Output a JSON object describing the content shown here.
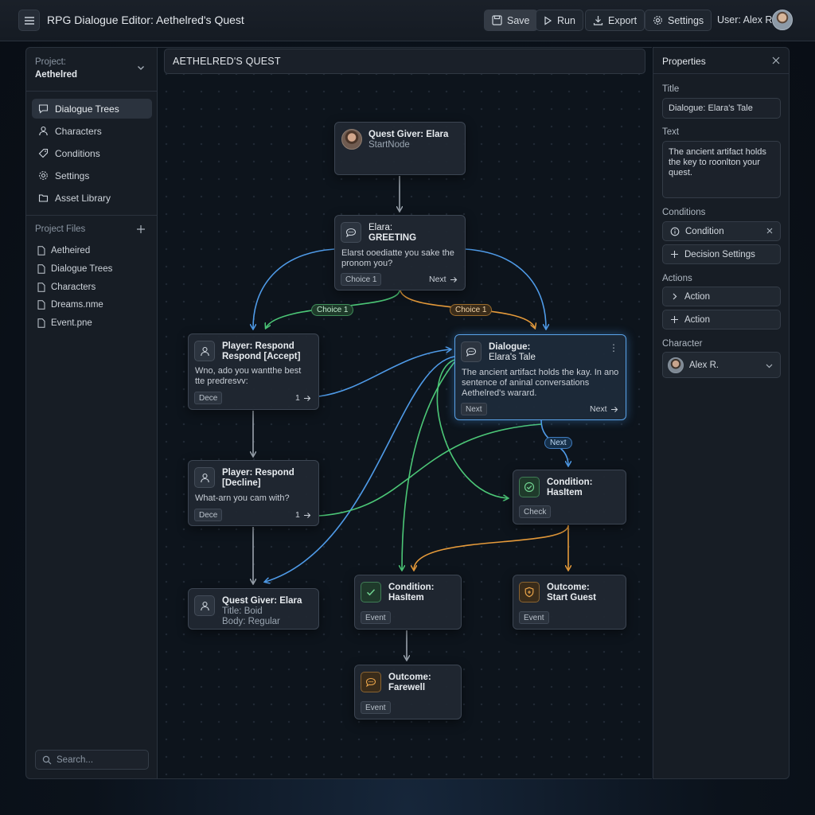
{
  "app": {
    "title": "RPG Dialogue Editor: Aethelred's Quest",
    "menu_icon": "hamburger-icon"
  },
  "toolbar": {
    "save_label": "Save",
    "run_label": "Run",
    "export_label": "Export",
    "settings_label": "Settings",
    "user_label": "User: Alex R."
  },
  "sidebar": {
    "project_label": "Project:",
    "project_name": "Aethelred",
    "nav": [
      {
        "label": "Dialogue Trees",
        "icon": "speech-bubble-icon",
        "active": true
      },
      {
        "label": "Characters",
        "icon": "person-icon"
      },
      {
        "label": "Conditions",
        "icon": "tag-icon"
      },
      {
        "label": "Settings",
        "icon": "gear-icon"
      },
      {
        "label": "Asset Library",
        "icon": "folder-icon"
      }
    ],
    "files_label": "Project Files",
    "files": [
      "Aetheired",
      "Dialogue Trees",
      "Characters",
      "Dreams.nme",
      "Event.pne"
    ],
    "search_placeholder": "Search..."
  },
  "canvas": {
    "header": "AETHELRED'S QUEST",
    "nodes": {
      "quest_giver": {
        "title": "Quest Giver: Elara",
        "sub": "StartNode"
      },
      "greeting": {
        "title": "Elara:",
        "title2": "GREETING",
        "body": "Elarst ooediatte you sake the pronom you?",
        "chip": "Choice 1",
        "next": "Next"
      },
      "accept": {
        "title": "Player: Respond",
        "title2": "Respond [Accept]",
        "body": "Wno, ado you wantthe best tte predresvv:",
        "chip": "Dece",
        "next": "1"
      },
      "elaras_tale": {
        "title": "Dialogue:",
        "title2": "Elara's Tale",
        "body": "The ancient artifact holds the kay. In ano sentence of aninal conversations Aethelred's warard.",
        "chip": "Next",
        "next": "Next"
      },
      "decline": {
        "title": "Player: Respond",
        "title2": "[Decline]",
        "body": "What-arn you cam with?",
        "chip": "Dece",
        "next": "1"
      },
      "condition_top": {
        "title": "Condition:",
        "title2": "HasItem",
        "chip": "Check"
      },
      "quest_giver_bottom": {
        "title": "Quest Giver: Elara",
        "line2": "Title: Boid",
        "line3": "Body: Regular"
      },
      "condition_bottom": {
        "title": "Condition:",
        "title2": "HasItem",
        "chip": "Event"
      },
      "outcome_start": {
        "title": "Outcome:",
        "title2": "Start Guest",
        "chip": "Event"
      },
      "outcome_farewell": {
        "title": "Outcome:",
        "title2": "Farewell",
        "chip": "Event"
      }
    },
    "edge_labels": {
      "choice_left": "Choice 1",
      "choice_right": "Choice 1",
      "next": "Next"
    }
  },
  "properties": {
    "header": "Properties",
    "title_label": "Title",
    "title_value": "Dialogue: Elara's Tale",
    "text_label": "Text",
    "text_value": "The ancient artifact holds the key to roonlton your quest.",
    "conditions_label": "Conditions",
    "condition_item": "Condition",
    "decision_settings": "Decision Settings",
    "actions_label": "Actions",
    "action_1": "Action",
    "action_2": "Action",
    "character_label": "Character",
    "character_value": "Alex R."
  },
  "colors": {
    "edge_blue": "#4f9be8",
    "edge_green": "#4cc777",
    "edge_orange": "#e59a3a",
    "edge_gray": "#9aa3ad",
    "selected_border": "#5aa2e8"
  }
}
